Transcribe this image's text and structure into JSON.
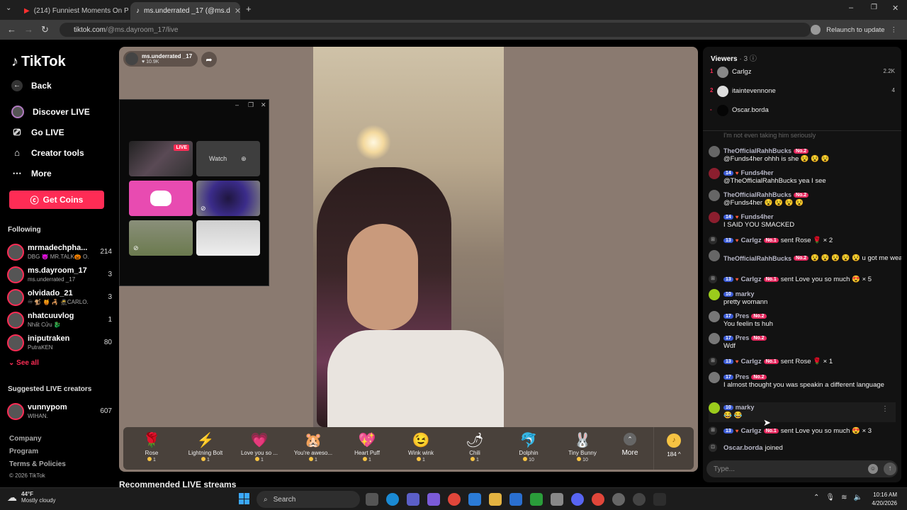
{
  "browser": {
    "tabs": [
      {
        "title": "(214) Funniest Moments On Po"
      },
      {
        "title": "ms.underrated _17 (@ms.d"
      }
    ],
    "url_host": "tiktok.com",
    "url_path": "/@ms.dayroom_17/live",
    "relaunch_label": "Relaunch to update"
  },
  "sidebar": {
    "brand": "TikTok",
    "back": "Back",
    "nav": [
      {
        "label": "Discover LIVE",
        "icon": "live-icon"
      },
      {
        "label": "Go LIVE",
        "icon": "camera-icon"
      },
      {
        "label": "Creator tools",
        "icon": "home-icon"
      },
      {
        "label": "More",
        "icon": "ellipsis-icon"
      }
    ],
    "coins_label": "Get Coins",
    "following_title": "Following",
    "following": [
      {
        "name": "mrmadechpha...",
        "sub": "DBG 😈 MR.TALK🎃 O...",
        "count": "214"
      },
      {
        "name": "ms.dayroom_17",
        "sub": "ms.underrated _17",
        "count": "3"
      },
      {
        "name": "olvidado_21",
        "sub": "♾ 🐒 🍯 🦂 🥷CARLO...",
        "count": "3"
      },
      {
        "name": "nhatcuuvlog",
        "sub": "Nhất Cửu 🐉",
        "count": "1"
      },
      {
        "name": "iniputraken",
        "sub": "PutraKEN",
        "count": "80"
      }
    ],
    "see_all": "See all",
    "suggested_title": "Suggested LIVE creators",
    "suggested": [
      {
        "name": "vunnypom",
        "sub": "WIHAN.",
        "count": "607"
      }
    ],
    "footer": [
      "Company",
      "Program",
      "Terms & Policies",
      "© 2026 TikTok"
    ]
  },
  "stream": {
    "host_name": "ms.underrated _17",
    "likes": "♥ 10.9K",
    "popup": {
      "live_badge": "LIVE",
      "watch_label": "Watch"
    },
    "gifts": [
      {
        "name": "Rose",
        "price": "1",
        "icon": "🌹"
      },
      {
        "name": "Lightning Bolt",
        "price": "1",
        "icon": "⚡"
      },
      {
        "name": "Love you so ...",
        "price": "1",
        "icon": "💗"
      },
      {
        "name": "You're aweso...",
        "price": "1",
        "icon": "🐹"
      },
      {
        "name": "Heart Puff",
        "price": "1",
        "icon": "💖"
      },
      {
        "name": "Wink wink",
        "price": "1",
        "icon": "😉"
      },
      {
        "name": "Chili",
        "price": "1",
        "icon": "🌶"
      },
      {
        "name": "Dolphin",
        "price": "10",
        "icon": "🐬"
      },
      {
        "name": "Tiny Bunny",
        "price": "10",
        "icon": "🐰"
      }
    ],
    "more_label": "More",
    "balance": "184",
    "recommended": "Recommended LIVE streams"
  },
  "viewers": {
    "title": "Viewers",
    "count": "3",
    "list": [
      {
        "rank": "1",
        "name": "Carlgz",
        "score": "2.2K"
      },
      {
        "rank": "2",
        "name": "itaintevennone",
        "score": "4"
      },
      {
        "rank": "-",
        "name": "Oscar.borda",
        "score": ""
      }
    ]
  },
  "chat": {
    "faded": "I'm not even taking him seriously",
    "messages": [
      {
        "kind": "msg",
        "name": "TheOfficialRahhBucks",
        "lvl": "",
        "no": "No.2",
        "text": "@Funds4her ohhh is she 😵 😵 😵"
      },
      {
        "kind": "msg",
        "name": "Funds4her",
        "lvl": "14",
        "no": "",
        "text": "@TheOfficialRahhBucks yea I see"
      },
      {
        "kind": "msg",
        "name": "TheOfficialRahhBucks",
        "lvl": "",
        "no": "No.2",
        "text": "@Funds4her 😵 😵 😵 😵"
      },
      {
        "kind": "msg",
        "name": "Funds4her",
        "lvl": "14",
        "no": "",
        "text": "I SAID YOU SMACKED"
      },
      {
        "kind": "gift",
        "name": "Carlgz",
        "lvl": "13",
        "no": "No.1",
        "text": "sent Rose 🌹 × 2"
      },
      {
        "kind": "msg",
        "name": "TheOfficialRahhBucks",
        "lvl": "",
        "no": "No.2",
        "text": "😵 😵 😵 😵 😵 u got me weak"
      },
      {
        "kind": "gift",
        "name": "Carlgz",
        "lvl": "13",
        "no": "No.1",
        "text": "sent Love you so much 😍 × 5"
      },
      {
        "kind": "msg",
        "name": "marky",
        "lvl": "10",
        "no": "",
        "text": "pretty womann"
      },
      {
        "kind": "msg",
        "name": "Pres",
        "lvl": "17",
        "no": "No.2",
        "text": "You feelin ts huh"
      },
      {
        "kind": "msg",
        "name": "Pres",
        "lvl": "17",
        "no": "No.2",
        "text": "Wdf"
      },
      {
        "kind": "gift",
        "name": "Carlgz",
        "lvl": "13",
        "no": "No.1",
        "text": "sent Rose 🌹 × 1"
      },
      {
        "kind": "msg",
        "name": "Pres",
        "lvl": "17",
        "no": "No.2",
        "text": "I almost thought you was speakin a different language"
      },
      {
        "kind": "msg",
        "name": "marky",
        "lvl": "10",
        "no": "",
        "text": "😂 😂"
      },
      {
        "kind": "gift",
        "name": "Carlgz",
        "lvl": "13",
        "no": "No.1",
        "text": "sent Love you so much 😍 × 3"
      },
      {
        "kind": "join",
        "name": "Oscar.borda",
        "lvl": "",
        "no": "",
        "text": "joined"
      }
    ],
    "input_placeholder": "Type..."
  },
  "taskbar": {
    "temp": "44°F",
    "weather": "Mostly cloudy",
    "search": "Search",
    "time": "10:16 AM",
    "date": "4/20/2026"
  }
}
